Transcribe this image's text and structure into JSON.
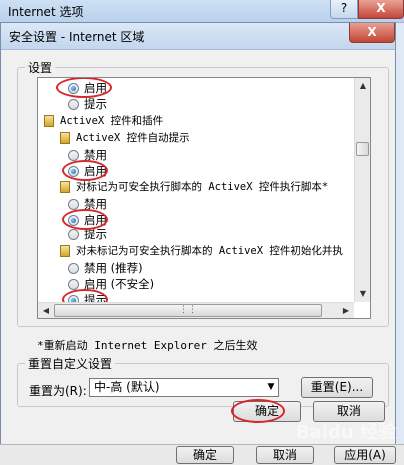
{
  "parent_window": {
    "title": "Internet 选项",
    "help_label": "?",
    "close_label": "X",
    "bottom_buttons": [
      "确定",
      "取消",
      "应用(A)"
    ]
  },
  "dialog": {
    "title": "安全设置 - Internet 区域",
    "close_label": "X",
    "settings_group_label": "设置",
    "settings_items": [
      {
        "kind": "radio",
        "label": "启用",
        "checked": true
      },
      {
        "kind": "radio",
        "label": "提示",
        "checked": false
      },
      {
        "kind": "category",
        "label": "ActiveX 控件和插件"
      },
      {
        "kind": "setting",
        "label": "ActiveX 控件自动提示"
      },
      {
        "kind": "radio",
        "label": "禁用",
        "checked": false
      },
      {
        "kind": "radio",
        "label": "启用",
        "checked": true
      },
      {
        "kind": "setting",
        "label": "对标记为可安全执行脚本的 ActiveX 控件执行脚本*"
      },
      {
        "kind": "radio",
        "label": "禁用",
        "checked": false
      },
      {
        "kind": "radio",
        "label": "启用",
        "checked": true
      },
      {
        "kind": "radio",
        "label": "提示",
        "checked": false
      },
      {
        "kind": "setting",
        "label": "对未标记为可安全执行脚本的 ActiveX 控件初始化并执"
      },
      {
        "kind": "radio",
        "label": "禁用 (推荐)",
        "checked": false
      },
      {
        "kind": "radio",
        "label": "启用 (不安全)",
        "checked": false
      },
      {
        "kind": "radio",
        "label": "提示",
        "checked": true
      }
    ],
    "restart_note": "*重新启动 Internet Explorer 之后生效",
    "reset_group_label": "重置自定义设置",
    "reset_to_label": "重置为(R):",
    "reset_level_value": "中-高 (默认)",
    "reset_button": "重置(E)...",
    "ok_button": "确定",
    "cancel_button": "取消"
  },
  "colors": {
    "highlight_ring": "#d8262b",
    "radio_dot": "#1a5fb4"
  },
  "watermark": "Baidu 经验"
}
